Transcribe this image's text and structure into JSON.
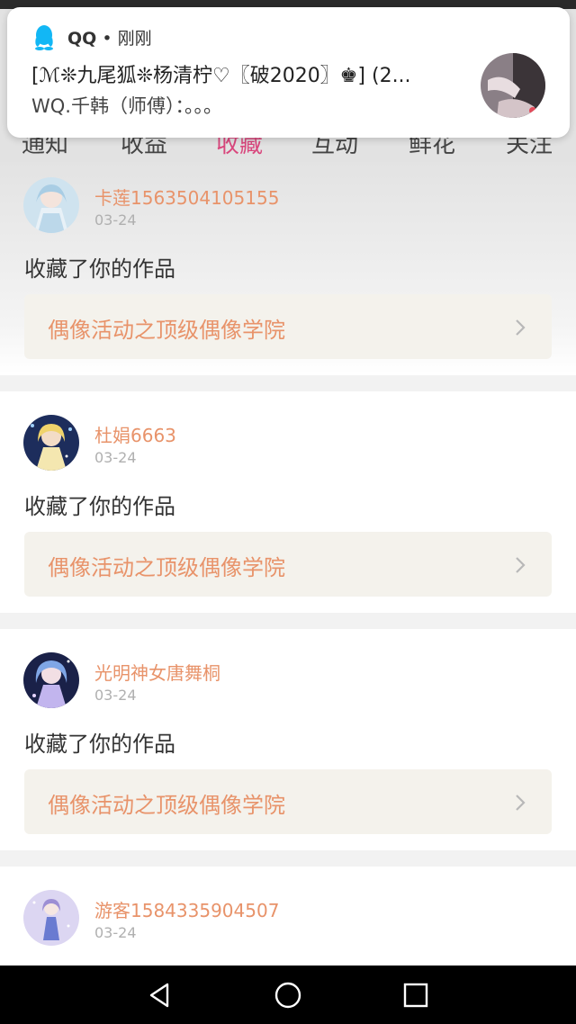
{
  "tabs": [
    {
      "label": "通知"
    },
    {
      "label": "收益"
    },
    {
      "label": "收藏"
    },
    {
      "label": "互动"
    },
    {
      "label": "鲜花"
    },
    {
      "label": "关注"
    }
  ],
  "active_tab": "收藏",
  "colors": {
    "accent": "#d9477d",
    "username": "#e8936a",
    "work_title": "#e8936a",
    "date": "#b0b0b0",
    "work_box_bg": "#f4f2ec"
  },
  "notification": {
    "app_name": "QQ",
    "separator": "•",
    "time": "刚刚",
    "title": "[ℳ❊九尾狐❊杨清柠♡〖破2020〗♚] (2...",
    "body": "WQ.千韩（师傅）：。。。",
    "app_icon": "qq-penguin-icon"
  },
  "items": [
    {
      "username": "卡莲1563504105155",
      "date": "03-24",
      "action": "收藏了你的作品",
      "work": "偶像活动之顶级偶像学院"
    },
    {
      "username": "杜娟6663",
      "date": "03-24",
      "action": "收藏了你的作品",
      "work": "偶像活动之顶级偶像学院"
    },
    {
      "username": "光明神女唐舞桐",
      "date": "03-24",
      "action": "收藏了你的作品",
      "work": "偶像活动之顶级偶像学院"
    },
    {
      "username": "游客1584335904507",
      "date": "03-24"
    }
  ],
  "navbar": {
    "back": "back-triangle-icon",
    "home": "home-circle-icon",
    "recents": "recents-square-icon"
  }
}
